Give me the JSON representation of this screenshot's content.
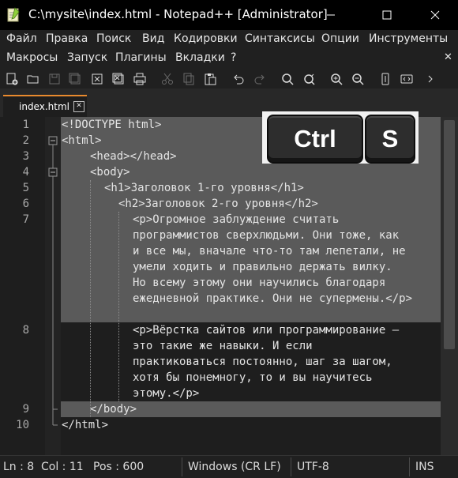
{
  "window": {
    "title": "C:\\mysite\\index.html - Notepad++ [Administrator]"
  },
  "menu": {
    "row1": [
      "Файл",
      "Правка",
      "Поиск",
      "Вид",
      "Кодировки",
      "Синтаксисы",
      "Опции",
      "Инструменты"
    ],
    "row2": [
      "Макросы",
      "Запуск",
      "Плагины",
      "Вкладки",
      "?"
    ]
  },
  "toolbar_icons": [
    "new-file-icon",
    "open-file-icon",
    "save-icon",
    "save-all-icon",
    "close-icon",
    "close-all-icon",
    "print-icon",
    "cut-icon",
    "copy-icon",
    "paste-icon",
    "undo-icon",
    "redo-icon",
    "find-icon",
    "replace-icon",
    "zoom-in-icon",
    "zoom-out-icon",
    "sync-scroll-icon",
    "wrap-icon"
  ],
  "tab": {
    "label": "index.html",
    "close": "✕"
  },
  "overlay": {
    "key1": "Ctrl",
    "key2": "S"
  },
  "editor": {
    "lines": [
      {
        "num": "1",
        "rows": [
          "<!DOCTYPE html>"
        ]
      },
      {
        "num": "2",
        "rows": [
          "<html>"
        ]
      },
      {
        "num": "3",
        "rows": [
          "<head></head>"
        ]
      },
      {
        "num": "4",
        "rows": [
          "<body>"
        ]
      },
      {
        "num": "5",
        "rows": [
          "<h1>Заголовок 1-го уровня</h1>"
        ]
      },
      {
        "num": "6",
        "rows": [
          "<h2>Заголовок 2-го уровня</h2>"
        ]
      },
      {
        "num": "7",
        "rows": [
          "<p>Огромное заблуждение считать",
          "программистов сверхлюдьми. Они тоже, как",
          "и все мы, вначале что-то там лепетали, не",
          "умели ходить и правильно держать вилку.",
          "Но всему этому они научились благодаря",
          "ежедневной практике. Они не супермены.</p>"
        ]
      },
      {
        "num": "8",
        "rows": [
          "<p>Вёрстка сайтов или программирование —",
          "это такие же навыки. И если",
          "практиковаться постоянно, шаг за шагом,",
          "хотя бы понемногу, то и вы научитесь",
          "этому.</p>"
        ]
      },
      {
        "num": "9",
        "rows": [
          "</body>"
        ]
      },
      {
        "num": "10",
        "rows": [
          "</html>"
        ]
      }
    ]
  },
  "status": {
    "ln": "Ln : 8",
    "col": "Col : 11",
    "pos": "Pos : 600",
    "eol": "Windows (CR LF)",
    "encoding": "UTF-8",
    "mode": "INS"
  }
}
